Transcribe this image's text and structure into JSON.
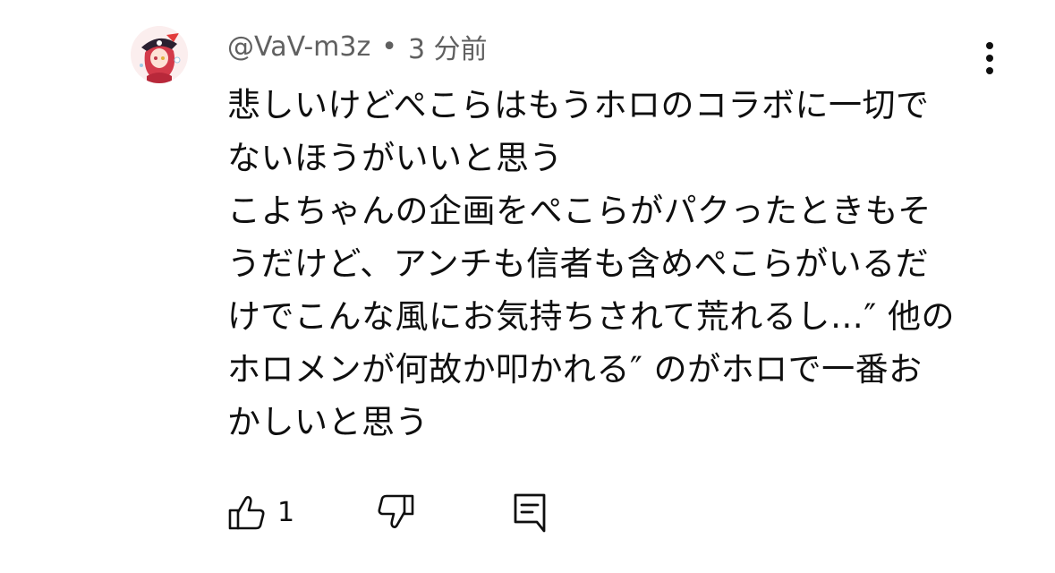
{
  "comment": {
    "author": "@VaV-m3z",
    "separator": "•",
    "time": "3 分前",
    "avatar_icon": "anime-pirate-avatar-icon",
    "lines": [
      "悲しいけどぺこらはもうホロのコラボに一切で",
      "ないほうがいいと思う",
      "こよちゃんの企画をぺこらがパクったときもそ",
      "うだけど、アンチも信者も含めぺこらがいるだ",
      "けでこんな風にお気持ちされて荒れるし…″ 他の",
      "ホロメンが何故か叩かれる″ のがホロで一番お",
      "かしいと思う"
    ],
    "like_count": "1",
    "icons": {
      "menu": "more-vertical-icon",
      "like": "thumbs-up-icon",
      "dislike": "thumbs-down-icon",
      "reply": "reply-comment-icon"
    }
  },
  "colors": {
    "text": "#0f0f0f",
    "meta": "#606060",
    "avatar_accent": "#d33a4a"
  }
}
